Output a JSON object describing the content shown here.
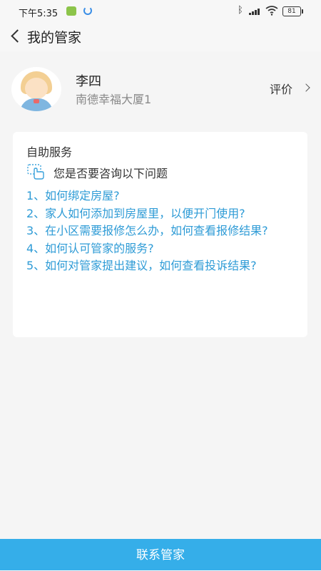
{
  "status_bar": {
    "time": "下午5:35",
    "battery": "81"
  },
  "header": {
    "title": "我的管家"
  },
  "butler": {
    "name": "李四",
    "address": "南德幸福大厦1",
    "rate_label": "评价"
  },
  "self_service": {
    "title": "自助服务",
    "prompt": "您是否要咨询以下问题",
    "questions": [
      "1、如何绑定房屋?",
      "2、家人如何添加到房屋里，以便开门使用?",
      "3、在小区需要报修怎么办，如何查看报修结果?",
      "4、如何认可管家的服务?",
      "5、如何对管家提出建议，如何查看投诉结果?"
    ]
  },
  "footer": {
    "contact_label": "联系管家"
  },
  "colors": {
    "accent": "#35aee9",
    "link": "#2e9bd6"
  },
  "icons": [
    "back-icon",
    "chevron-right-icon",
    "hand-pointer-icon",
    "avatar"
  ]
}
